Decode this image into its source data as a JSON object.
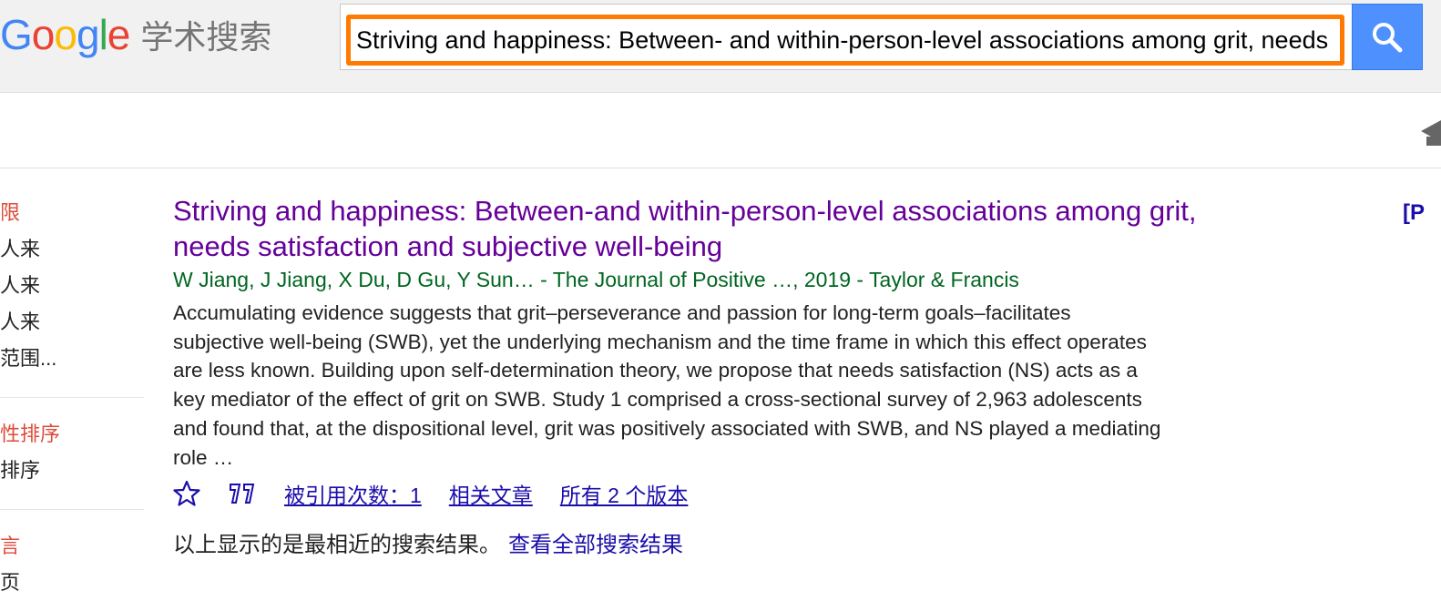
{
  "logo": {
    "google_letters": [
      "G",
      "o",
      "o",
      "g",
      "l",
      "e"
    ],
    "google_colors": [
      "#4285f4",
      "#ea4335",
      "#fbbc05",
      "#4285f4",
      "#34a853",
      "#ea4335"
    ],
    "subtitle": "学术搜索"
  },
  "search": {
    "value": "Striving and happiness: Between- and within-person-level associations among grit, needs satisfaction and subjective well-being",
    "button_icon": "search-icon"
  },
  "sidebar": {
    "time_group": [
      {
        "label": "限",
        "red": true
      },
      {
        "label": "人来",
        "red": false
      },
      {
        "label": "人来",
        "red": false
      },
      {
        "label": "人来",
        "red": false
      },
      {
        "label": "范围...",
        "red": false
      }
    ],
    "sort_group": [
      {
        "label": "性排序",
        "red": true
      },
      {
        "label": "排序",
        "red": false
      }
    ],
    "lang_group": [
      {
        "label": "言",
        "red": true
      },
      {
        "label": "页",
        "red": false
      }
    ]
  },
  "result": {
    "title": "Striving and happiness: Between-and within-person-level associations among grit, needs satisfaction and subjective well-being",
    "meta": "W Jiang, J Jiang, X Du, D Gu, Y Sun… - The Journal of Positive …, 2019 - Taylor & Francis",
    "snippet": "Accumulating evidence suggests that grit–perseverance and passion for long-term goals–facilitates subjective well-being (SWB), yet the underlying mechanism and the time frame in which this effect operates are less known. Building upon self-determination theory, we propose that needs satisfaction (NS) acts as a key mediator of the effect of grit on SWB. Study 1 comprised a cross-sectional survey of 2,963 adolescents and found that, at the dispositional level, grit was positively associated with SWB, and NS played a mediating role …",
    "cited_by": "被引用次数：1",
    "related": "相关文章",
    "versions": "所有 2 个版本",
    "side_tag": "[P"
  },
  "notice": {
    "text": "以上显示的是最相近的搜索结果。",
    "link": "查看全部搜索结果"
  },
  "colors": {
    "header_bg": "#f1f1f1",
    "search_border_highlight": "#ff7a00",
    "search_button": "#4d90fe",
    "title_visited": "#660099",
    "meta_green": "#006621",
    "link_blue": "#1a0dab",
    "sidebar_red": "#dd4b39"
  }
}
